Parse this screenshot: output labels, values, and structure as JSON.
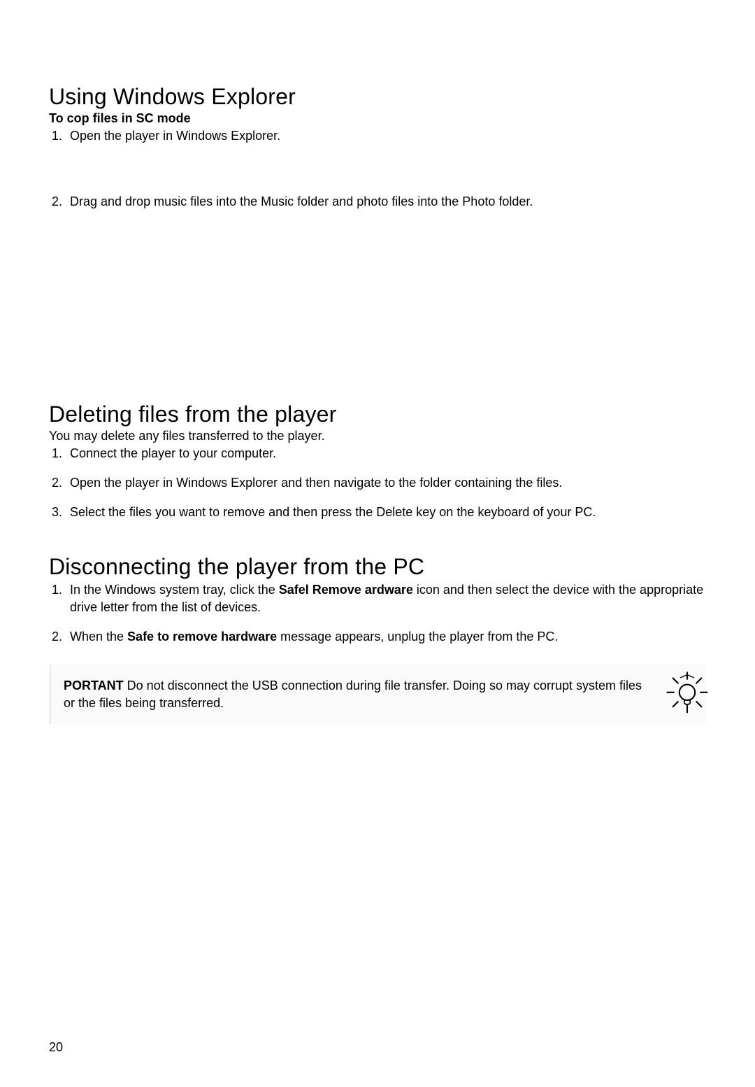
{
  "section1": {
    "heading": "Using Windows Explorer",
    "subhead": "To cop  files in  SC mode",
    "items": [
      "Open the player in Windows Explorer.",
      "Drag and drop music files into the Music folder and photo files into the Photo folder."
    ]
  },
  "section2": {
    "heading": "Deleting files from the player",
    "lead": "You may delete any files transferred to the player.",
    "items": [
      "Connect the player to your computer.",
      "Open the player in Windows Explorer and then navigate to the folder containing the files.",
      "Select the files you want to remove and then press the Delete key on the keyboard of your PC."
    ]
  },
  "section3": {
    "heading": "Disconnecting the player from the PC",
    "item1_pre": "In the Windows system tray, click the ",
    "item1_bold": "Safel  Remove  ardware",
    "item1_post": " icon          and then select the device with the appropriate drive letter from the list of devices.",
    "item2_pre": "When the ",
    "item2_bold": "Safe to remove hardware ",
    "item2_post": "message appears, unplug the player from the PC."
  },
  "callout": {
    "label": "PORTANT",
    "text": "       Do not disconnect the USB connection during file transfer. Doing so may corrupt system files or the files being transferred."
  },
  "page_number": "20"
}
